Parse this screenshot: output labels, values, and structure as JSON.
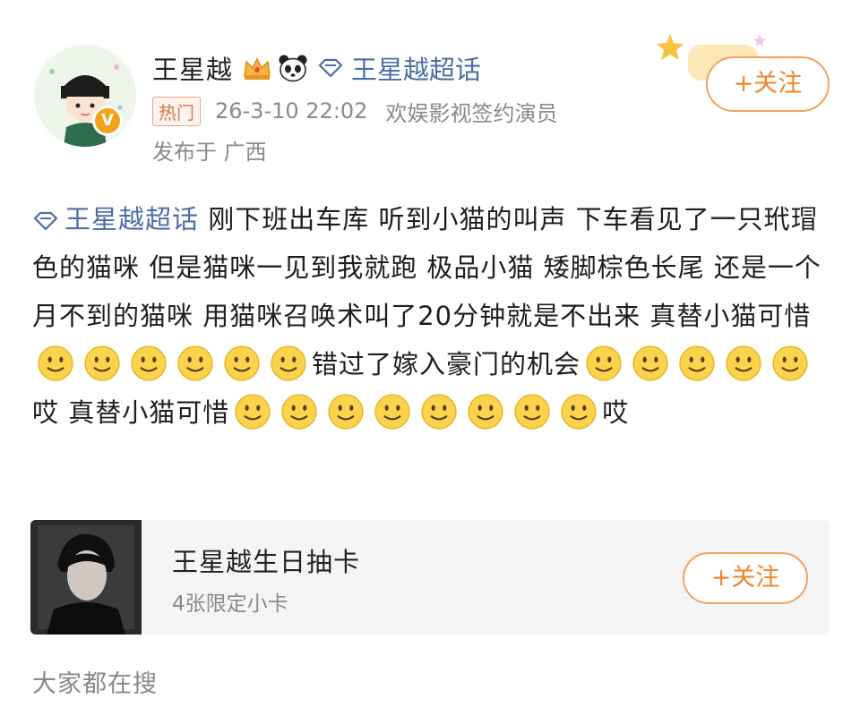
{
  "user": {
    "name": "王星越",
    "supertopic": "王星越超话",
    "hot_tag": "热门",
    "time": "26-3-10 22:02",
    "description": "欢娱影视签约演员",
    "location": "发布于 广西",
    "follow_label": "+关注"
  },
  "post": {
    "topic": "王星越超话",
    "seg1": " 刚下班出车库 听到小猫的叫声 下车看见了一只玳瑁色的猫咪 但是猫咪一见到我就跑 极品小猫 矮脚棕色长尾 还是一个月不到的猫咪 用猫咪召唤术叫了20分钟就是不出来 真替小猫可惜",
    "seg2": "错过了嫁入豪门的机会",
    "seg3": "哎 真替小猫可惜",
    "seg4": "哎",
    "emoji_icon": "smile-emoji"
  },
  "card": {
    "title": "王星越生日抽卡",
    "subtitle": "4张限定小卡",
    "follow_label": "+关注"
  },
  "footer": {
    "search_label": "大家都在搜"
  },
  "colors": {
    "accent": "#f0862a",
    "link": "#4a6fa5",
    "muted": "#8a8a8a"
  }
}
